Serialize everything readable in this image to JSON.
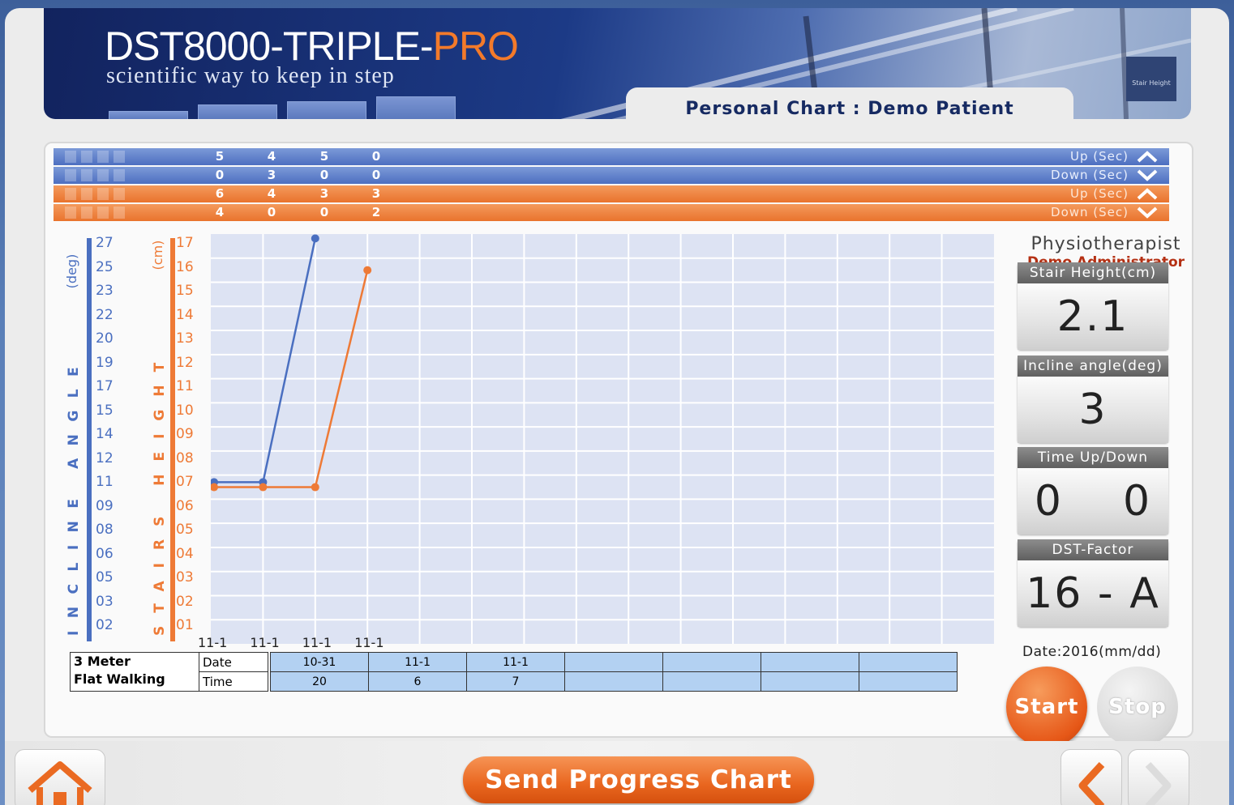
{
  "header": {
    "brand_main": "DST8000-TRIPLE-",
    "brand_accent": "PRO",
    "tagline": "scientific way to keep in step",
    "sign_text": "Stair Height",
    "chart_title": "Personal Chart : Demo Patient"
  },
  "summary_bars": [
    {
      "values": [
        "5",
        "4",
        "5",
        "0"
      ],
      "label": "Up  (Sec)",
      "color": "#5476c6",
      "direction": "up"
    },
    {
      "values": [
        "0",
        "3",
        "0",
        "0"
      ],
      "label": "Down (Sec)",
      "color": "#5476c6",
      "direction": "down"
    },
    {
      "values": [
        "6",
        "4",
        "3",
        "3"
      ],
      "label": "Up  (Sec)",
      "color": "#ee7a36",
      "direction": "up"
    },
    {
      "values": [
        "4",
        "0",
        "0",
        "2"
      ],
      "label": "Down (Sec)",
      "color": "#ee7a36",
      "direction": "down"
    }
  ],
  "axes": {
    "incline_title": "INCLINE ANGLE",
    "incline_unit": "(deg)",
    "incline_ticks": [
      "27",
      "25",
      "23",
      "22",
      "20",
      "19",
      "17",
      "15",
      "14",
      "12",
      "11",
      "09",
      "08",
      "06",
      "05",
      "03",
      "02"
    ],
    "stairs_title": "STAIRS HEIGHT",
    "stairs_unit": "(cm)",
    "stairs_ticks": [
      "17",
      "16",
      "15",
      "14",
      "13",
      "12",
      "11",
      "10",
      "09",
      "08",
      "07",
      "06",
      "05",
      "04",
      "03",
      "02",
      "01"
    ],
    "x_labels": [
      "11-1",
      "11-1",
      "11-1",
      "11-1"
    ]
  },
  "chart_data": {
    "type": "line",
    "x": [
      "11-1",
      "11-1",
      "11-1",
      "11-1"
    ],
    "series": [
      {
        "color": "#4a6fc0",
        "axis": "incline",
        "values": [
          11.7,
          11.7,
          27.5,
          null
        ]
      },
      {
        "color": "#ee7a36",
        "axis": "stairs",
        "values": [
          7.0,
          7.0,
          7.0,
          16.0
        ]
      }
    ],
    "ylim_stairs": [
      1,
      17
    ],
    "ylim_incline": [
      2,
      27
    ],
    "columns": 15,
    "rows": 17,
    "grid": true
  },
  "side": {
    "role": "Physiotherapist",
    "name": "Demo Administrator",
    "cards": [
      {
        "label": "Stair Height(cm)",
        "value": "2.1"
      },
      {
        "label": "Incline angle(deg)",
        "value": "3"
      },
      {
        "label": "Time Up/Down",
        "value": "0    0"
      },
      {
        "label": "DST-Factor",
        "value": "16 - A"
      }
    ],
    "date_label": "Date:2016(mm/dd)",
    "start_label": "Start",
    "stop_label": "Stop"
  },
  "flat_walking": {
    "title_line1": "3 Meter",
    "title_line2": "Flat Walking",
    "date_label": "Date",
    "time_label": "Time",
    "dates": [
      "10-31",
      "11-1",
      "11-1",
      "",
      "",
      "",
      "",
      ""
    ],
    "times": [
      "20",
      "6",
      "7",
      "",
      "",
      "",
      "",
      ""
    ]
  },
  "footer": {
    "send_label": "Send Progress Chart"
  }
}
